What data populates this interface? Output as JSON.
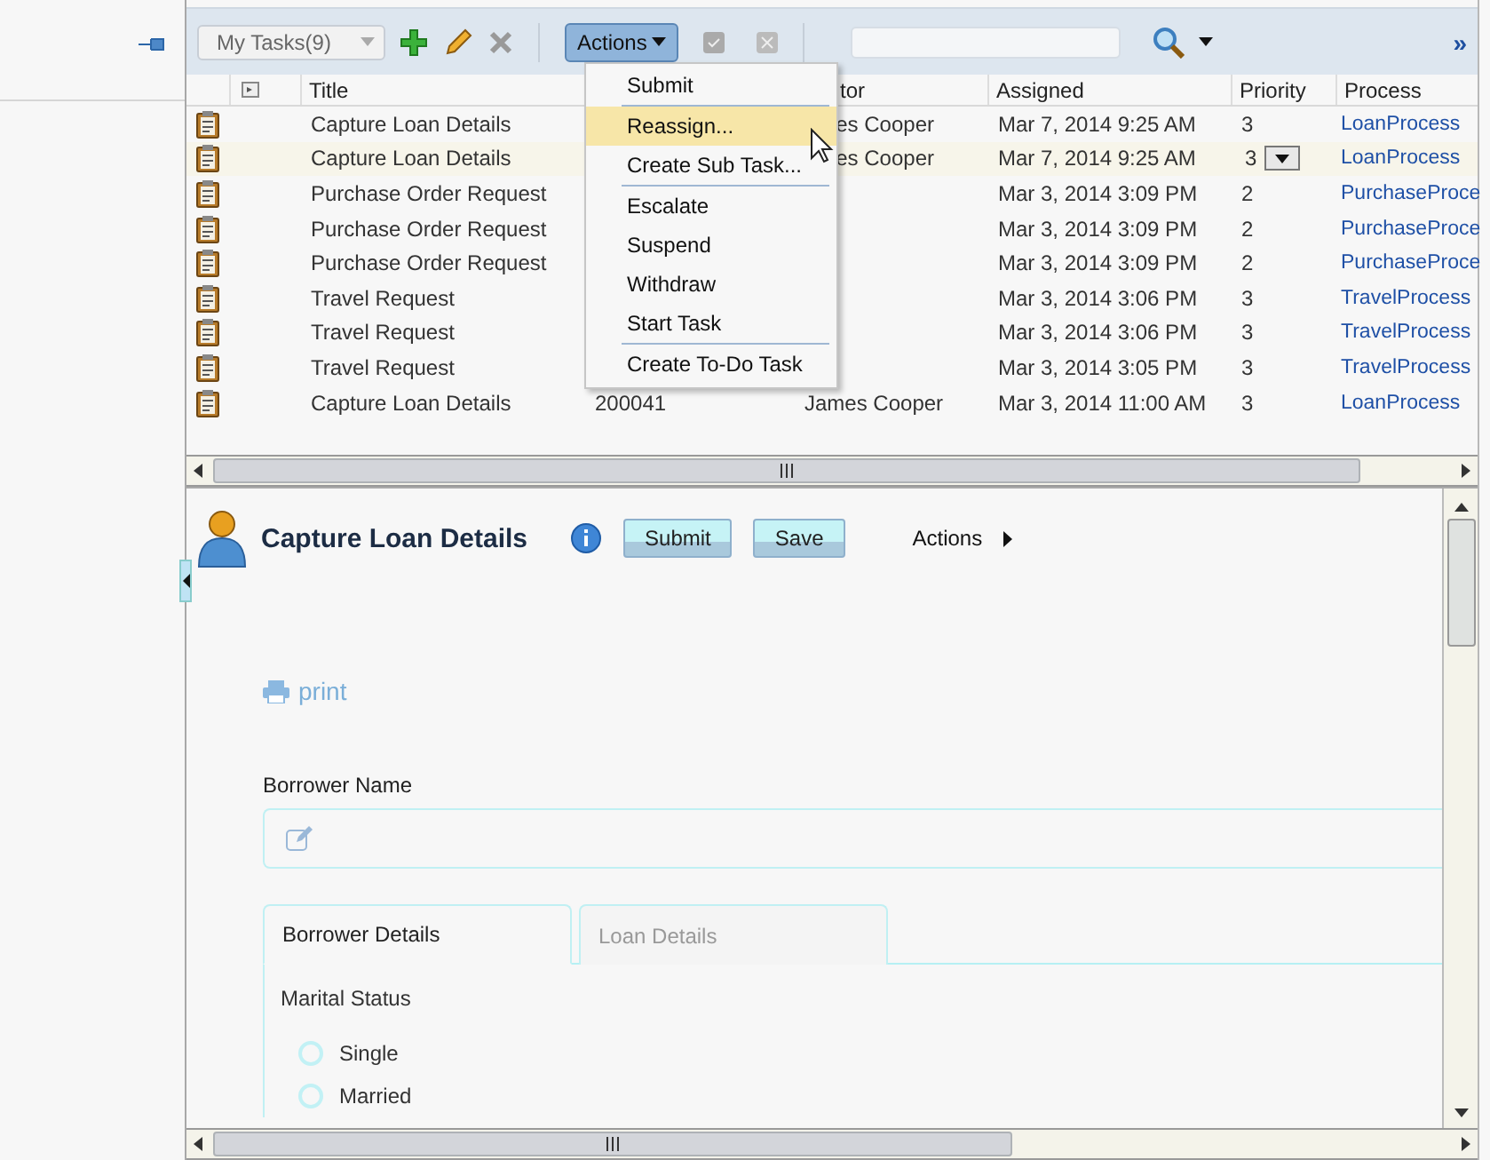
{
  "toolbar": {
    "view": "My Tasks(9)",
    "actions_label": "Actions",
    "actions_open": true,
    "more": "»"
  },
  "table": {
    "columns": [
      "Title",
      "tor",
      "Assigned",
      "Priority",
      "Process"
    ],
    "rows": [
      {
        "title": "Capture Loan Details",
        "number": "",
        "creator": "es Cooper",
        "assigned": "Mar 7, 2014 9:25 AM",
        "priority": "3",
        "process": "LoanProcess",
        "selected": false
      },
      {
        "title": "Capture Loan Details",
        "number": "",
        "creator": "es Cooper",
        "assigned": "Mar 7, 2014 9:25 AM",
        "priority": "3",
        "process": "LoanProcess",
        "selected": true
      },
      {
        "title": "Purchase Order Request",
        "number": "",
        "creator": "",
        "assigned": "Mar 3, 2014 3:09 PM",
        "priority": "2",
        "process": "PurchaseProce",
        "selected": false
      },
      {
        "title": "Purchase Order Request",
        "number": "",
        "creator": "",
        "assigned": "Mar 3, 2014 3:09 PM",
        "priority": "2",
        "process": "PurchaseProce",
        "selected": false
      },
      {
        "title": "Purchase Order Request",
        "number": "",
        "creator": "",
        "assigned": "Mar 3, 2014 3:09 PM",
        "priority": "2",
        "process": "PurchaseProce",
        "selected": false
      },
      {
        "title": "Travel Request",
        "number": "",
        "creator": "",
        "assigned": "Mar 3, 2014 3:06 PM",
        "priority": "3",
        "process": "TravelProcess",
        "selected": false
      },
      {
        "title": "Travel Request",
        "number": "",
        "creator": "",
        "assigned": "Mar 3, 2014 3:06 PM",
        "priority": "3",
        "process": "TravelProcess",
        "selected": false
      },
      {
        "title": "Travel Request",
        "number": "",
        "creator": "",
        "assigned": "Mar 3, 2014 3:05 PM",
        "priority": "3",
        "process": "TravelProcess",
        "selected": false
      },
      {
        "title": "Capture Loan Details",
        "number": "200041",
        "creator": "James Cooper",
        "assigned": "Mar 3, 2014 11:00 AM",
        "priority": "3",
        "process": "LoanProcess",
        "selected": false
      }
    ]
  },
  "menu": {
    "groups": [
      {
        "items": [
          {
            "label": "Submit",
            "selected": false
          }
        ]
      },
      {
        "items": [
          {
            "label": "Reassign...",
            "selected": true
          },
          {
            "label": "Create Sub Task...",
            "selected": false
          }
        ]
      },
      {
        "items": [
          {
            "label": "Escalate",
            "selected": false
          },
          {
            "label": "Suspend",
            "selected": false
          },
          {
            "label": "Withdraw",
            "selected": false
          },
          {
            "label": "Start Task",
            "selected": false
          }
        ]
      },
      {
        "items": [
          {
            "label": "Create To-Do Task",
            "selected": false
          }
        ]
      }
    ]
  },
  "detail": {
    "title": "Capture Loan Details",
    "buttons": [
      "Submit",
      "Save"
    ],
    "actions": "Actions",
    "print": "print",
    "field_label": "Borrower Name",
    "tabs": [
      {
        "label": "Borrower Details",
        "selected": true
      },
      {
        "label": "Loan Details",
        "selected": false
      }
    ],
    "section": "Marital Status",
    "options": [
      {
        "label": "Single",
        "selected": false
      },
      {
        "label": "Married",
        "selected": false
      }
    ]
  }
}
